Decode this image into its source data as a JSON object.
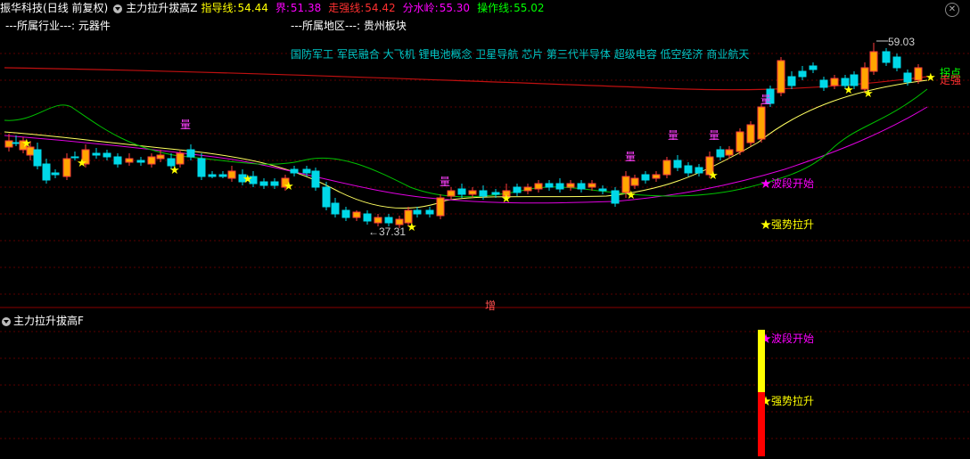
{
  "header": {
    "stock_name": "振华科技",
    "period": "(日线 前复权)",
    "indicator_name": "主力拉升拔高Z",
    "fields": [
      {
        "label": "指导线:",
        "value": "54.44",
        "color": "#ffff00"
      },
      {
        "label": "界:",
        "value": "51.38",
        "color": "#ff00ff"
      },
      {
        "label": "走强线:",
        "value": "54.42",
        "color": "#ff3030"
      },
      {
        "label": "分水岭:",
        "value": "55.30",
        "color": "#ff00ff"
      },
      {
        "label": "操作线:",
        "value": "55.02",
        "color": "#00ff00"
      }
    ]
  },
  "info": {
    "industry_label": "---所属行业---:",
    "industry_value": "元器件",
    "region_label": "---所属地区---:",
    "region_value": "贵州板块"
  },
  "concepts": "国防军工 军民融合 大飞机 锂电池概念 卫星导航 芯片 第三代半导体 超级电容 低空经济 商业航天",
  "chart_labels": {
    "high_price": "59.03",
    "low_price": "37.31",
    "liang_mark": "量",
    "wave_start": "★波段开始",
    "strong_rise": "★强势拉升",
    "zeng_mark": "增",
    "right_edge_1": "拐点",
    "right_edge_2": "走强"
  },
  "sub_panel": {
    "title": "主力拉升拔高F",
    "wave_start": "★波段开始",
    "strong_rise": "★强势拉升"
  },
  "colors": {
    "up": "#ff3c3c",
    "up_fill": "#ffa500",
    "down": "#00d8e8",
    "guide_line": "#ffff60",
    "ma_magenta": "#e000e0",
    "ma_green": "#00c000",
    "red_curve": "#c01010"
  }
}
